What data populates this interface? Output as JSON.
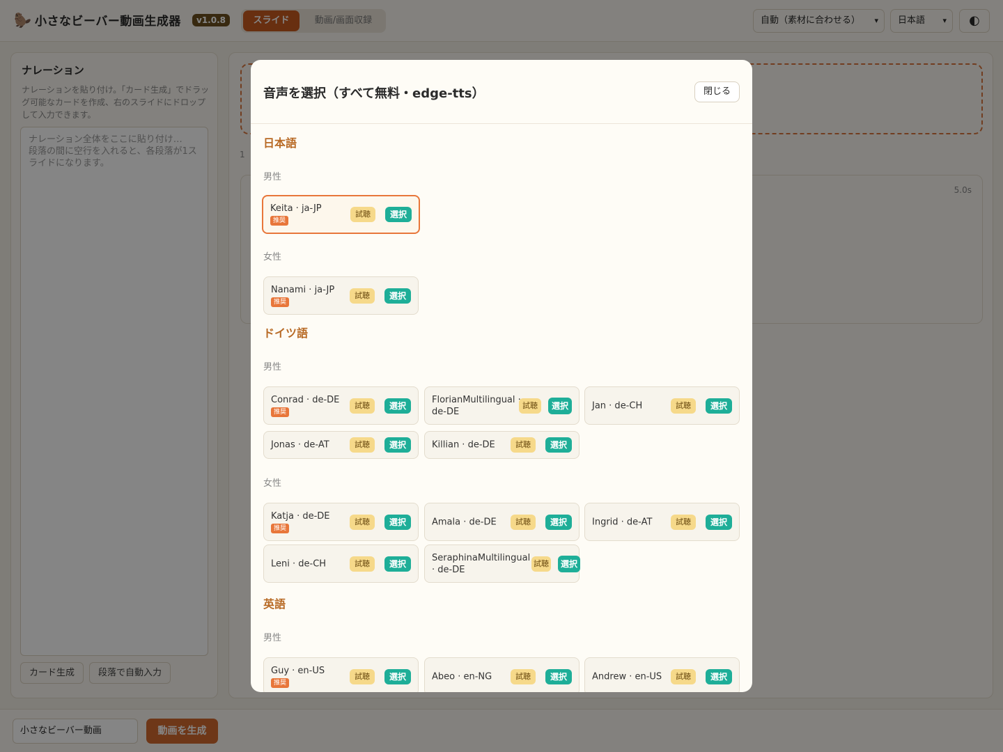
{
  "app": {
    "title": "小さなビーバー動画生成器",
    "version": "v1.0.8",
    "logo_icon": "beaver-icon"
  },
  "tabs": [
    {
      "label": "スライド",
      "active": true
    },
    {
      "label": "動画/画面収録",
      "active": false
    }
  ],
  "header": {
    "mode_select": "自動（素材に合わせる）",
    "lang_select": "日本語",
    "theme_icon": "contrast-icon"
  },
  "left_panel": {
    "title": "ナレーション",
    "description": "ナレーションを貼り付け。「カード生成」でドラッグ可能なカードを作成、右のスライドにドロップして入力できます。",
    "placeholder": "ナレーション全体をここに貼り付け…\n段落の間に空行を入れると、各段落が1スライドになります。",
    "buttons": {
      "generate_cards": "カード生成",
      "auto_fill": "段落で自動入力"
    }
  },
  "right_panel": {
    "count_prefix": "1",
    "duration": "5.0s"
  },
  "bottom": {
    "project_name": "小さなビーバー動画",
    "generate_label": "動画を生成"
  },
  "modal": {
    "title": "音声を選択（すべて無料・edge-tts）",
    "close_label": "閉じる",
    "listen_label": "試聴",
    "choose_label": "選択",
    "recommended_label": "推奨",
    "languages": [
      {
        "name": "日本語",
        "male_label": "男性",
        "male": [
          {
            "name": "Keita · ja-JP",
            "recommended": true
          }
        ],
        "female_label": "女性",
        "female": [
          {
            "name": "Nanami · ja-JP",
            "recommended": true
          }
        ]
      },
      {
        "name": "ドイツ語",
        "male_label": "男性",
        "male": [
          {
            "name": "Conrad · de-DE",
            "recommended": true
          },
          {
            "name": "FlorianMultilingual · de-DE",
            "recommended": false
          },
          {
            "name": "Jan · de-CH",
            "recommended": false
          },
          {
            "name": "Jonas · de-AT",
            "recommended": false
          },
          {
            "name": "Killian · de-DE",
            "recommended": false
          }
        ],
        "female_label": "女性",
        "female": [
          {
            "name": "Katja · de-DE",
            "recommended": true
          },
          {
            "name": "Amala · de-DE",
            "recommended": false
          },
          {
            "name": "Ingrid · de-AT",
            "recommended": false
          },
          {
            "name": "Leni · de-CH",
            "recommended": false
          },
          {
            "name": "SeraphinaMultilingual · de-DE",
            "recommended": false
          }
        ]
      },
      {
        "name": "英語",
        "male_label": "男性",
        "male": [
          {
            "name": "Guy · en-US",
            "recommended": true
          },
          {
            "name": "Abeo · en-NG",
            "recommended": false
          },
          {
            "name": "Andrew · en-US",
            "recommended": false
          }
        ]
      }
    ]
  }
}
